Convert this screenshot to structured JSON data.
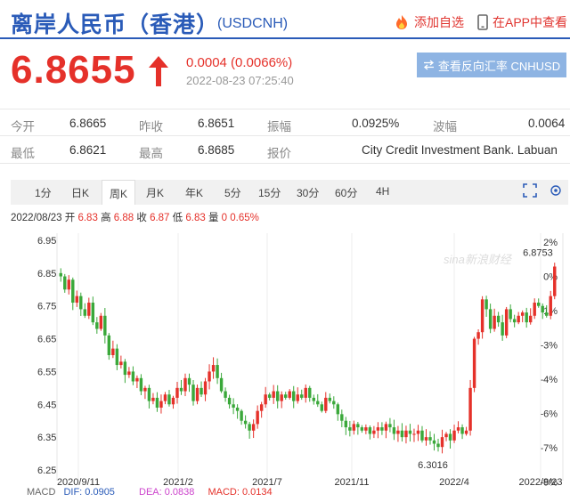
{
  "header": {
    "title": "离岸人民币（香港）",
    "code": "(USDCNH)",
    "watch_label": "添加自选",
    "app_label": "在APP中查看"
  },
  "quote": {
    "price": "6.8655",
    "change": "0.0004 (0.0066%)",
    "time": "2022-08-23 07:25:40",
    "reverse_label": "查看反向汇率 CNHUSD"
  },
  "stats": {
    "row1": [
      {
        "label": "今开",
        "value": "6.8665"
      },
      {
        "label": "昨收",
        "value": "6.8651"
      },
      {
        "label": "振幅",
        "value": "0.0925%"
      },
      {
        "label": "波幅",
        "value": "0.0064"
      }
    ],
    "row2": [
      {
        "label": "最低",
        "value": "6.8621"
      },
      {
        "label": "最高",
        "value": "6.8685"
      },
      {
        "label": "报价",
        "value": "City Credit Investment Bank. Labuan"
      }
    ]
  },
  "tabs": [
    "1分",
    "日K",
    "周K",
    "月K",
    "年K",
    "5分",
    "15分",
    "30分",
    "60分",
    "4H"
  ],
  "active_tab": "周K",
  "kline_info": {
    "date": "2022/08/23",
    "open_label": "开",
    "open": "6.83",
    "high_label": "高",
    "high": "6.88",
    "close_label": "收",
    "close": "6.87",
    "low_label": "低",
    "low": "6.83",
    "vol_label": "量",
    "vol": "0",
    "pct": "0.65%"
  },
  "macd": {
    "label": "MACD",
    "dif": "DIF: 0.0905",
    "dea": "DEA: 0.0838",
    "macd": "MACD: 0.0134"
  },
  "colors": {
    "up": "#e5312a",
    "down": "#3aa83a",
    "brand": "#2a5bb8"
  },
  "chart_data": {
    "type": "candlestick",
    "y_ticks": [
      "6.95",
      "6.85",
      "6.75",
      "6.65",
      "6.55",
      "6.45",
      "6.35",
      "6.25"
    ],
    "right_ticks": [
      "2%",
      "0%",
      "-1%",
      "-3%",
      "-4%",
      "-6%",
      "-7%",
      "-9%"
    ],
    "x_labels": [
      "2020/9/11",
      "2021/2",
      "2021/7",
      "2021/11",
      "2022/4",
      "2022/8/23"
    ],
    "ylim": [
      6.25,
      6.95
    ],
    "watermark": "sina新浪财经",
    "high_label": "6.8753",
    "low_label": "6.3016",
    "close": [
      6.84,
      6.8,
      6.83,
      6.76,
      6.78,
      6.74,
      6.72,
      6.76,
      6.7,
      6.68,
      6.72,
      6.66,
      6.6,
      6.62,
      6.57,
      6.58,
      6.54,
      6.55,
      6.52,
      6.53,
      6.49,
      6.5,
      6.46,
      6.47,
      6.44,
      6.46,
      6.48,
      6.45,
      6.47,
      6.5,
      6.49,
      6.53,
      6.51,
      6.46,
      6.5,
      6.48,
      6.52,
      6.55,
      6.57,
      6.53,
      6.49,
      6.47,
      6.45,
      6.44,
      6.43,
      6.4,
      6.39,
      6.37,
      6.39,
      6.43,
      6.45,
      6.48,
      6.47,
      6.49,
      6.46,
      6.48,
      6.47,
      6.49,
      6.46,
      6.48,
      6.47,
      6.5,
      6.47,
      6.46,
      6.45,
      6.43,
      6.47,
      6.46,
      6.45,
      6.42,
      6.4,
      6.38,
      6.37,
      6.39,
      6.38,
      6.37,
      6.38,
      6.36,
      6.37,
      6.38,
      6.37,
      6.39,
      6.38,
      6.36,
      6.37,
      6.35,
      6.37,
      6.36,
      6.36,
      6.37,
      6.34,
      6.35,
      6.34,
      6.33,
      6.32,
      6.35,
      6.36,
      6.34,
      6.37,
      6.38,
      6.36,
      6.37,
      6.5,
      6.65,
      6.67,
      6.77,
      6.74,
      6.68,
      6.72,
      6.7,
      6.66,
      6.74,
      6.71,
      6.7,
      6.72,
      6.73,
      6.7,
      6.72,
      6.76,
      6.75,
      6.73,
      6.72,
      6.78,
      6.87
    ]
  }
}
